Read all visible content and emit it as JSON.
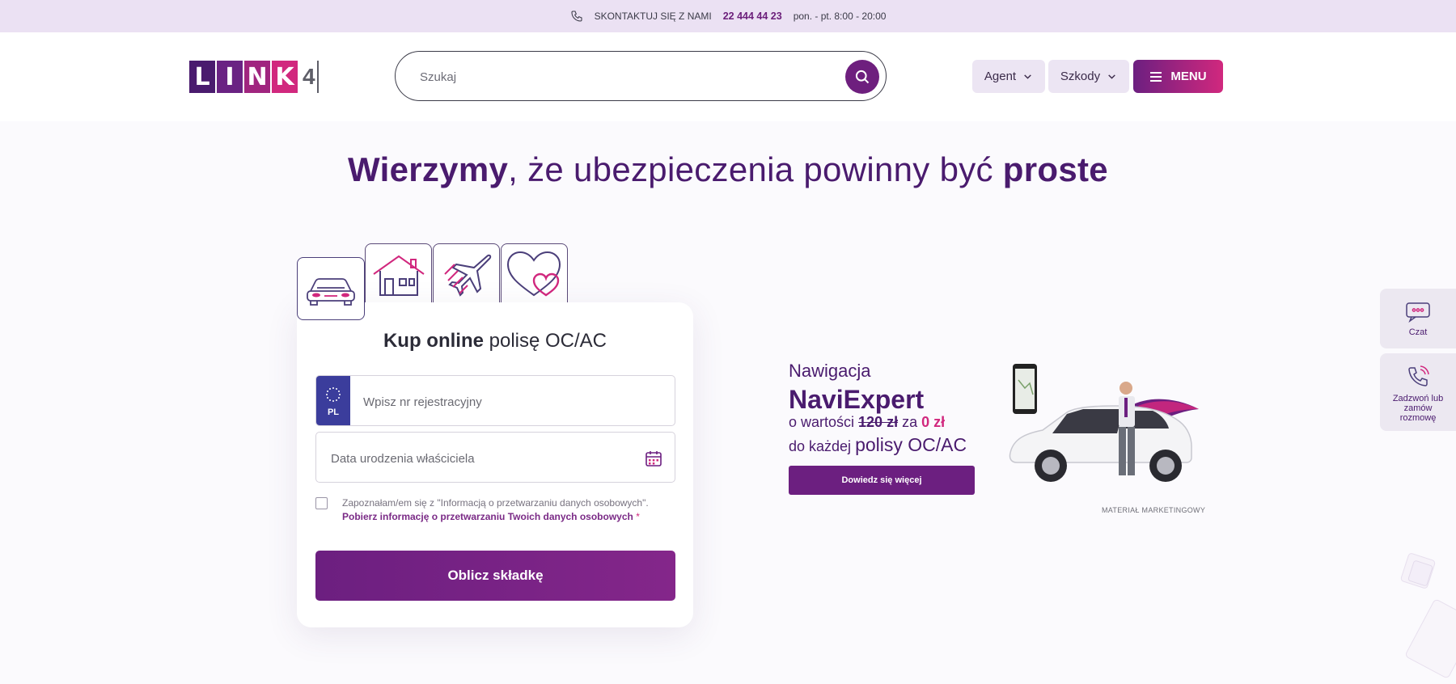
{
  "topbar": {
    "contact_label": "SKONTAKTUJ SIĘ Z NAMI",
    "phone": "22 444 44 23",
    "hours": "pon. - pt. 8:00 - 20:00"
  },
  "header": {
    "logo_letters": [
      "L",
      "I",
      "N",
      "K"
    ],
    "logo_number": "4",
    "search_placeholder": "Szukaj",
    "agent_label": "Agent",
    "szkody_label": "Szkody",
    "menu_label": "MENU"
  },
  "hero": {
    "bold1": "Wierzymy",
    "middle": ", że ubezpieczenia powinny być ",
    "bold2": "proste"
  },
  "products": [
    "car-icon",
    "house-icon",
    "plane-icon",
    "heart-icon"
  ],
  "form": {
    "title_bold": "Kup online",
    "title_rest": " polisę OC/AC",
    "plate_country": "PL",
    "plate_placeholder": "Wpisz nr rejestracyjny",
    "dob_placeholder": "Data urodzenia właściciela",
    "consent_text": "Zapoznałam/em się z \"Informacją o przetwarzaniu danych osobowych\". ",
    "consent_link": "Pobierz informację o przetwarzaniu Twoich danych osobowych",
    "consent_required": "*",
    "submit_label": "Oblicz składkę"
  },
  "promo": {
    "line1": "Nawigacja",
    "line2": "NaviExpert",
    "line3_prefix": "o wartości ",
    "old_price": "120 zł",
    "line3_mid": " za ",
    "new_price": "0 zł",
    "line4_prefix": "do każdej ",
    "line4_big": "polisy OC/AC",
    "button": "Dowiedz się więcej",
    "marketing_note": "MATERIAŁ MARKETINGOWY"
  },
  "side": {
    "chat_label": "Czat",
    "call_label": "Zadzwoń lub zamów rozmowę"
  },
  "colors": {
    "brand_purple": "#6c1f80",
    "brand_pink": "#d1287e",
    "heading": "#4a1b6e",
    "logo_cells": [
      "#4a1b6e",
      "#6a2383",
      "#a0257f",
      "#d1287e"
    ]
  }
}
